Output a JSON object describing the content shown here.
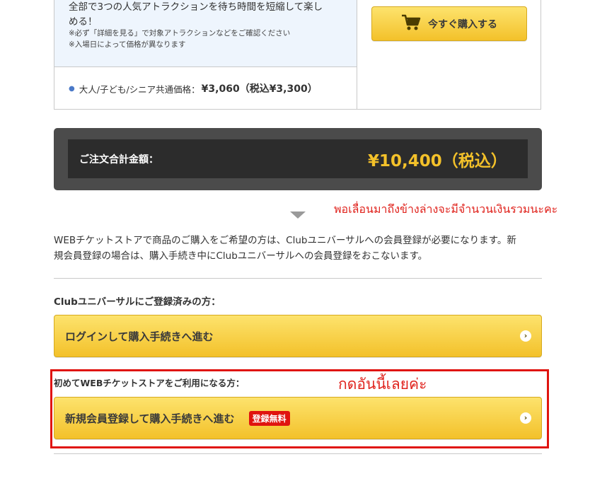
{
  "product": {
    "desc_line1": "全部で3つの人気アトラクションを待ち時間を短縮して楽し",
    "desc_line2": "める！",
    "note1": "※必ず「詳細を見る」で対象アトラクションなどをご確認ください",
    "note2": "※入場日によって価格が異なります",
    "price_label": "大人/子ども/シニア共通価格：",
    "price_value": "¥3,060（税込¥3,300）",
    "buy_button": "今すぐ購入する",
    "buy_icon": "cart-icon"
  },
  "total": {
    "label": "ご注文合計金額：",
    "value": "¥10,400（税込）"
  },
  "annotation_scroll": "พอเลื่อนมาถึงข้างล่างจะมีจำนวนเงินรวมนะคะ",
  "info_paragraph": {
    "line1": "WEBチケットストアで商品のご購入をご希望の方は、Clubユニバーサルへの会員登録が必要になります。新",
    "line2": "規会員登録の場合は、購入手続き中にClubユニバーサルへの会員登録をおこないます。"
  },
  "registered": {
    "label": "Clubユニバーサルにご登録済みの方：",
    "button": "ログインして購入手続きへ進む"
  },
  "new_user": {
    "label": "初めてWEBチケットストアをご利用になる方：",
    "button": "新規会員登録して購入手続きへ進む",
    "badge": "登録無料"
  },
  "annotation_click": "กดอันนี้เลยค่ะ",
  "colors": {
    "accent": "#f3c12a",
    "annotation": "#e0231d",
    "total_bg": "#4b4b4b"
  }
}
